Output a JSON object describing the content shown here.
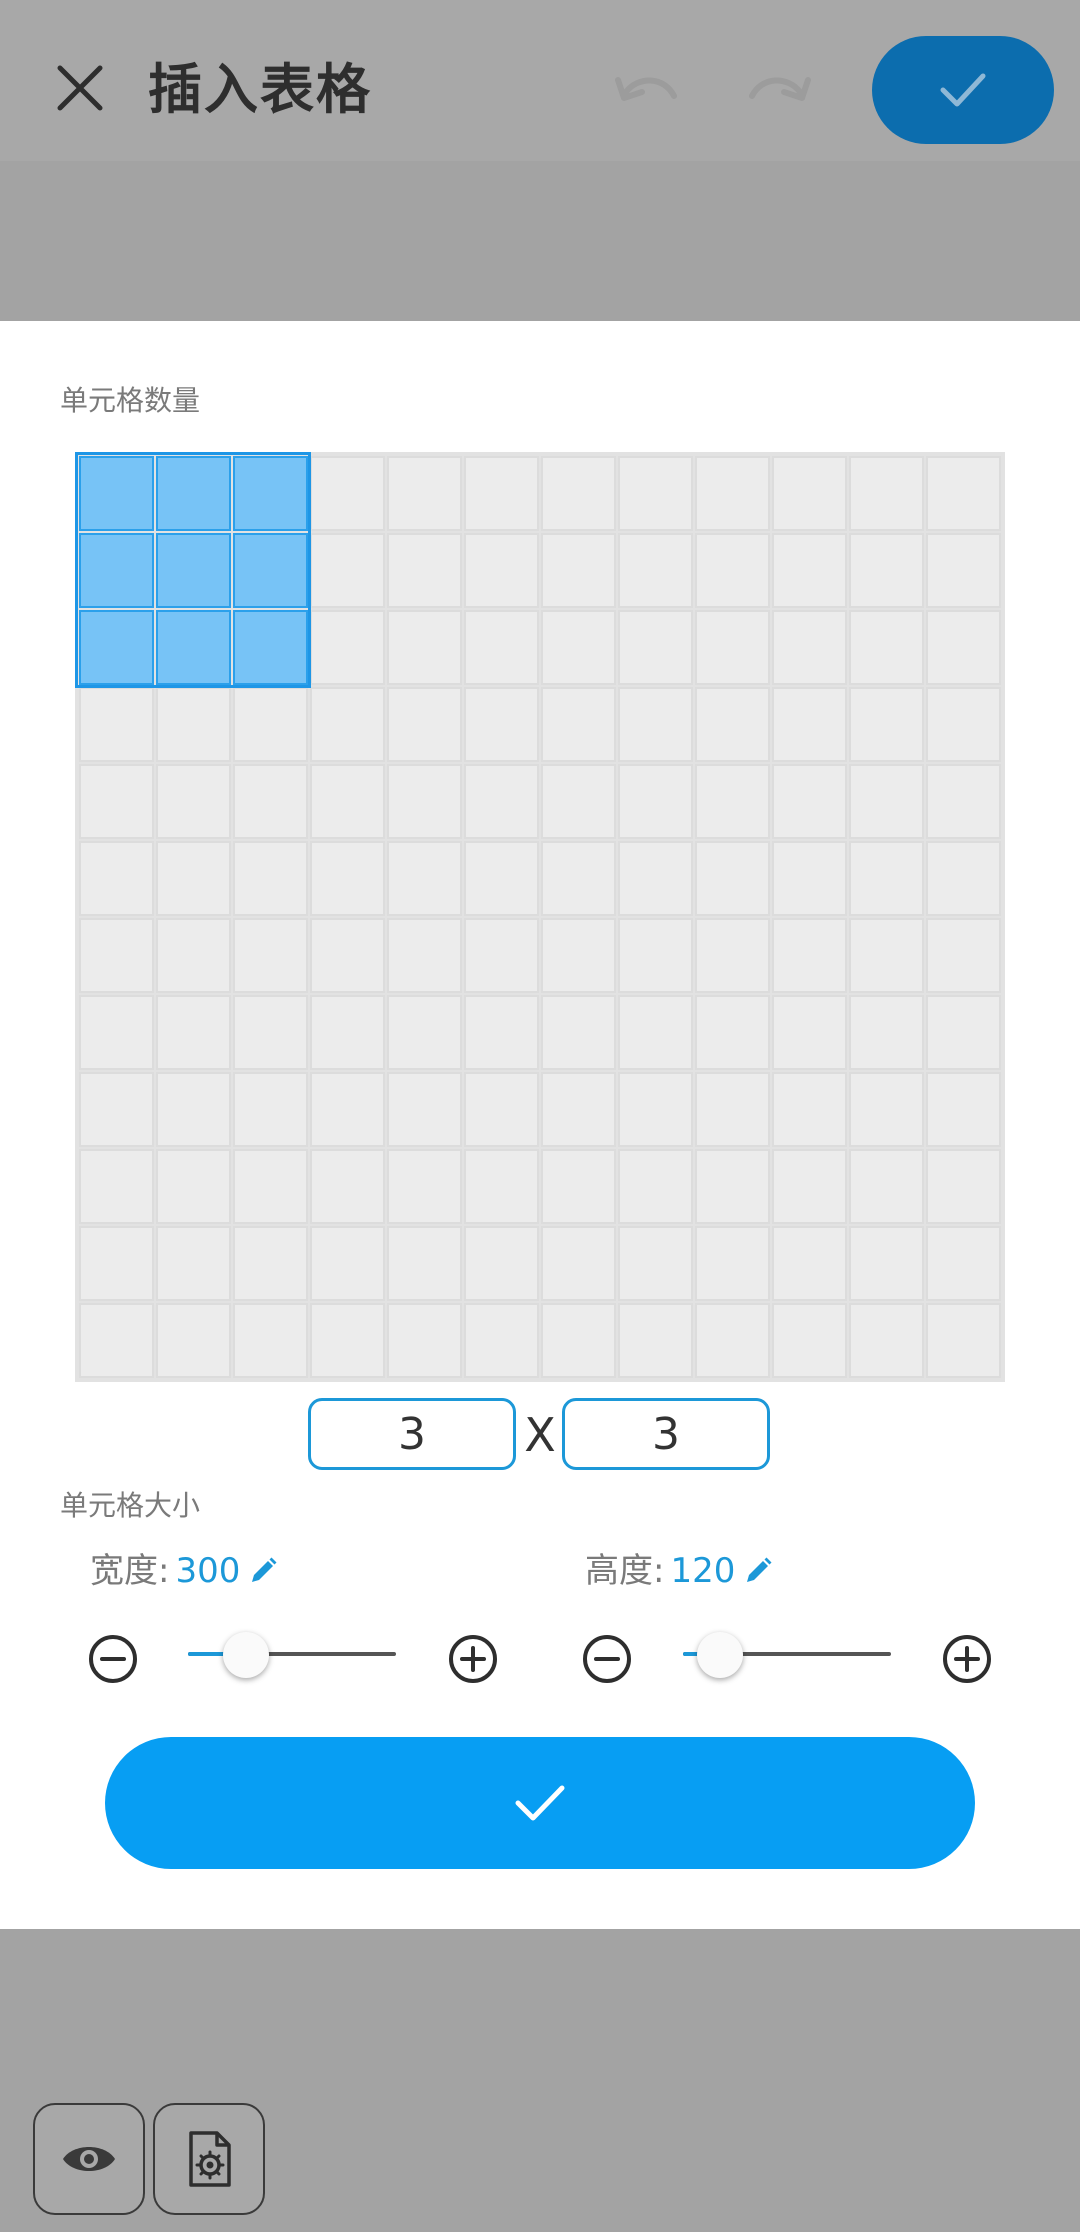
{
  "toolbar": {
    "title": "插入表格"
  },
  "dialog": {
    "cell_count_label": "单元格数量",
    "grid": {
      "rows_total": 12,
      "cols_total": 12,
      "selected_rows": 3,
      "selected_cols": 3
    },
    "rows_value": "3",
    "times_sign": "X",
    "cols_value": "3",
    "cell_size_label": "单元格大小",
    "width_label": "宽度:",
    "width_value": "300",
    "height_label": "高度:",
    "height_value": "120",
    "width_slider_level": 0.28,
    "height_slider_level": 0.18
  },
  "colors": {
    "accent": "#079ef3",
    "accent_dark": "#0c6dae",
    "selected_cell": "#77c3f6",
    "empty_cell": "#ececec"
  },
  "icons": [
    "close-icon",
    "undo-icon",
    "redo-icon",
    "check-icon",
    "pencil-icon",
    "minus-circle-icon",
    "plus-circle-icon",
    "eye-icon",
    "file-settings-icon"
  ]
}
